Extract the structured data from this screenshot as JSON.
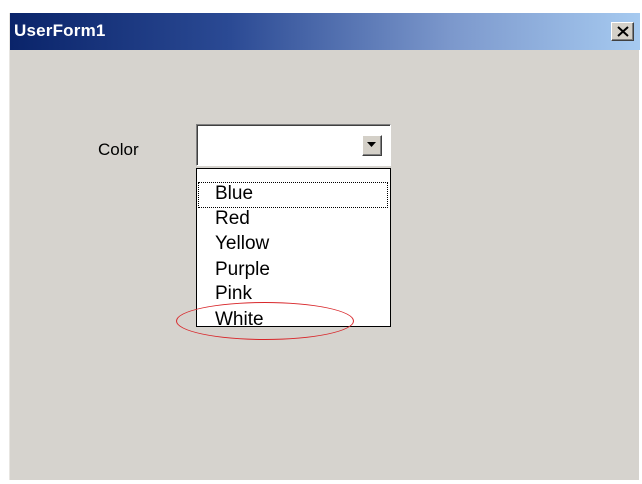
{
  "window": {
    "title": "UserForm1"
  },
  "form": {
    "color_label": "Color",
    "combo_value": "",
    "options": [
      "Blue",
      "Red",
      "Yellow",
      "Purple",
      "Pink",
      "White"
    ],
    "focused_option": "Blue",
    "highlighted_option": "White"
  },
  "icons": {
    "close": "close-icon",
    "dropdown": "chevron-down-icon"
  },
  "colors": {
    "titlebar_start": "#0a246a",
    "titlebar_end": "#a6caf0",
    "form_background": "#d6d3ce",
    "annotation": "#d8262a"
  }
}
